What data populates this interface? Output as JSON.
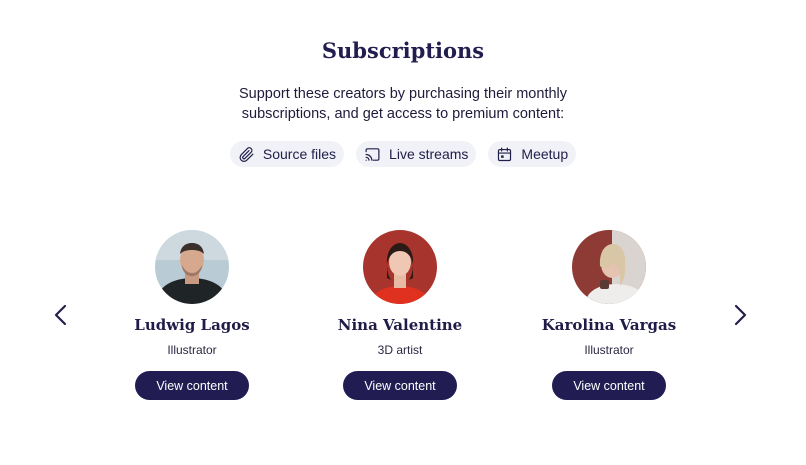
{
  "header": {
    "title": "Subscriptions",
    "subtitle": "Support these creators by purchasing their monthly subscriptions, and get access to premium content:"
  },
  "features": [
    {
      "label": "Source files",
      "icon": "paperclip-icon"
    },
    {
      "label": "Live streams",
      "icon": "cast-icon"
    },
    {
      "label": "Meetup",
      "icon": "calendar-icon"
    }
  ],
  "carousel": {
    "prev_icon": "chevron-left-icon",
    "next_icon": "chevron-right-icon"
  },
  "creators": [
    {
      "name": "Ludwig Lagos",
      "role": "Illustrator",
      "button": "View content"
    },
    {
      "name": "Nina Valentine",
      "role": "3D artist",
      "button": "View content"
    },
    {
      "name": "Karolina Vargas",
      "role": "Illustrator",
      "button": "View content"
    }
  ],
  "colors": {
    "primary": "#211d52",
    "chip_bg": "#f1f1f8",
    "text": "#1e1b3a"
  }
}
